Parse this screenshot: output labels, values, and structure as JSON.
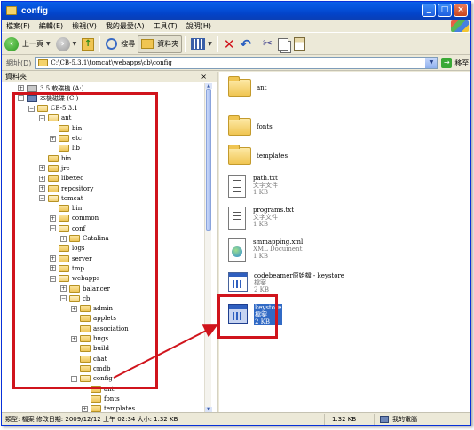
{
  "window": {
    "title": "config"
  },
  "menu": {
    "items": [
      "檔案(F)",
      "編輯(E)",
      "檢視(V)",
      "我的最愛(A)",
      "工具(T)",
      "說明(H)"
    ]
  },
  "toolbar": {
    "back_label": "上一頁",
    "search_label": "搜尋",
    "folders_label": "資料夾"
  },
  "address": {
    "label": "網址(D)",
    "path": "C:\\CB-5.3.1\\tomcat\\webapps\\cb\\config",
    "go_label": "移至"
  },
  "folder_pane": {
    "title": "資料夾",
    "tree": [
      {
        "label": "3.5 軟碟機 (A:)",
        "exp": "+",
        "icon": "floppy-drive-icon"
      },
      {
        "label": "本機磁碟 (C:)",
        "exp": "−",
        "icon": "local-disk-icon"
      },
      {
        "label": "CB-5.3.1",
        "exp": "−",
        "icon": "folder-open-icon"
      },
      {
        "label": "ant",
        "exp": "−",
        "icon": "folder-open-icon"
      },
      {
        "label": "bin",
        "exp": "",
        "icon": "folder-icon"
      },
      {
        "label": "etc",
        "exp": "+",
        "icon": "folder-icon"
      },
      {
        "label": "lib",
        "exp": "",
        "icon": "folder-icon"
      },
      {
        "label": "bin",
        "exp": "",
        "icon": "folder-icon"
      },
      {
        "label": "jre",
        "exp": "+",
        "icon": "folder-icon"
      },
      {
        "label": "libexec",
        "exp": "+",
        "icon": "folder-icon"
      },
      {
        "label": "repository",
        "exp": "+",
        "icon": "folder-icon"
      },
      {
        "label": "tomcat",
        "exp": "−",
        "icon": "folder-open-icon"
      },
      {
        "label": "bin",
        "exp": "",
        "icon": "folder-icon"
      },
      {
        "label": "common",
        "exp": "+",
        "icon": "folder-icon"
      },
      {
        "label": "conf",
        "exp": "−",
        "icon": "folder-open-icon"
      },
      {
        "label": "Catalina",
        "exp": "+",
        "icon": "folder-icon"
      },
      {
        "label": "logs",
        "exp": "",
        "icon": "folder-icon"
      },
      {
        "label": "server",
        "exp": "+",
        "icon": "folder-icon"
      },
      {
        "label": "tmp",
        "exp": "+",
        "icon": "folder-icon"
      },
      {
        "label": "webapps",
        "exp": "−",
        "icon": "folder-open-icon"
      },
      {
        "label": "balancer",
        "exp": "+",
        "icon": "folder-icon"
      },
      {
        "label": "cb",
        "exp": "−",
        "icon": "folder-open-icon"
      },
      {
        "label": "admin",
        "exp": "+",
        "icon": "folder-icon"
      },
      {
        "label": "applets",
        "exp": "",
        "icon": "folder-icon"
      },
      {
        "label": "association",
        "exp": "",
        "icon": "folder-icon"
      },
      {
        "label": "bugs",
        "exp": "+",
        "icon": "folder-icon"
      },
      {
        "label": "build",
        "exp": "",
        "icon": "folder-icon"
      },
      {
        "label": "chat",
        "exp": "",
        "icon": "folder-icon"
      },
      {
        "label": "cmdb",
        "exp": "",
        "icon": "folder-icon"
      },
      {
        "label": "config",
        "exp": "−",
        "icon": "folder-open-icon"
      },
      {
        "label": "ant",
        "exp": "",
        "icon": "folder-icon"
      },
      {
        "label": "fonts",
        "exp": "",
        "icon": "folder-icon"
      },
      {
        "label": "templates",
        "exp": "+",
        "icon": "folder-icon"
      }
    ]
  },
  "files": [
    {
      "name": "ant",
      "type": "folder"
    },
    {
      "name": "fonts",
      "type": "folder"
    },
    {
      "name": "templates",
      "type": "folder"
    },
    {
      "name": "path.txt",
      "kind": "文字文件",
      "size": "1 KB",
      "type": "text"
    },
    {
      "name": "programs.txt",
      "kind": "文字文件",
      "size": "1 KB",
      "type": "text"
    },
    {
      "name": "smmapping.xml",
      "kind": "XML Document",
      "size": "1 KB",
      "type": "xml"
    },
    {
      "name": "codebeamer原始檔 - keystore",
      "kind": "檔案",
      "size": "2 KB",
      "type": "file"
    },
    {
      "name": "keystore",
      "kind": "檔案",
      "size": "2 KB",
      "type": "file",
      "selected": true
    }
  ],
  "status": {
    "info": "類型: 檔案 修改日期: 2009/12/12 上午 02:34 大小: 1.32 KB",
    "size": "1.32 KB",
    "location": "我的電腦"
  },
  "colors": {
    "highlight": "#d0141c",
    "selection": "#316ac5",
    "titlebar": "#0450d9"
  }
}
